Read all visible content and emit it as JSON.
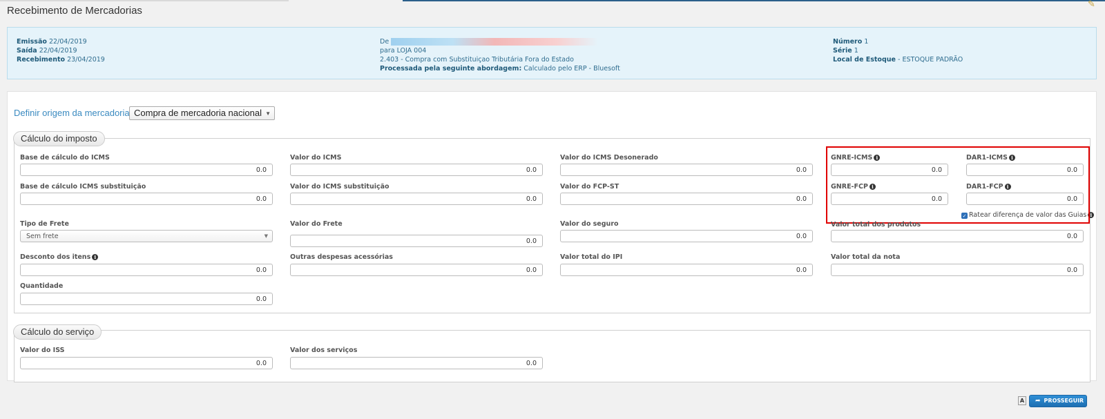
{
  "page": {
    "title": "Recebimento de Mercadorias"
  },
  "info": {
    "emissao_label": "Emissão",
    "emissao_value": "22/04/2019",
    "saida_label": "Saída",
    "saida_value": "22/04/2019",
    "recebimento_label": "Recebimento",
    "recebimento_value": "23/04/2019",
    "de_label": "De",
    "para_text": "para LOJA 004",
    "cfop_text": "2.403 - Compra com Substituiçao Tributária Fora do Estado",
    "processada_label": "Processada pela seguinte abordagem:",
    "processada_value": "Calculado pelo ERP - Bluesoft",
    "numero_label": "Número",
    "numero_value": "1",
    "serie_label": "Série",
    "serie_value": "1",
    "local_label": "Local de Estoque",
    "local_value": "- ESTOQUE PADRÃO"
  },
  "origin": {
    "label": "Definir origem da mercadoria",
    "selected": "Compra de mercadoria nacional"
  },
  "imposto": {
    "legend": "Cálculo do imposto",
    "base_icms": {
      "label": "Base de cálculo do ICMS",
      "value": "0.0"
    },
    "valor_icms": {
      "label": "Valor do ICMS",
      "value": "0.0"
    },
    "icms_desonerado": {
      "label": "Valor do ICMS Desonerado",
      "value": "0.0"
    },
    "gnre_icms": {
      "label": "GNRE-ICMS",
      "value": "0.0"
    },
    "dar1_icms": {
      "label": "DAR1-ICMS",
      "value": "0.0"
    },
    "base_icms_st": {
      "label": "Base de cálculo ICMS substituição",
      "value": "0.0"
    },
    "valor_icms_st": {
      "label": "Valor do ICMS substituição",
      "value": "0.0"
    },
    "fcp_st": {
      "label": "Valor do FCP-ST",
      "value": "0.0"
    },
    "gnre_fcp": {
      "label": "GNRE-FCP",
      "value": "0.0"
    },
    "dar1_fcp": {
      "label": "DAR1-FCP",
      "value": "0.0"
    },
    "ratear_label": "Ratear diferença de valor das Guias",
    "tipo_frete": {
      "label": "Tipo de Frete",
      "selected": "Sem frete"
    },
    "valor_frete": {
      "label": "Valor do Frete",
      "value": "0.0"
    },
    "valor_seguro": {
      "label": "Valor do seguro",
      "value": "0.0"
    },
    "total_produtos": {
      "label": "Valor total dos produtos",
      "value": "0.0"
    },
    "desconto_itens": {
      "label": "Desconto dos itens",
      "value": "0.0"
    },
    "outras_despesas": {
      "label": "Outras despesas acessórias",
      "value": "0.0"
    },
    "total_ipi": {
      "label": "Valor total do IPI",
      "value": "0.0"
    },
    "total_nota": {
      "label": "Valor total da nota",
      "value": "0.0"
    },
    "quantidade": {
      "label": "Quantidade",
      "value": "0.0"
    }
  },
  "servico": {
    "legend": "Cálculo do serviço",
    "valor_iss": {
      "label": "Valor do ISS",
      "value": "0.0"
    },
    "valor_servicos": {
      "label": "Valor dos serviços",
      "value": "0.0"
    }
  },
  "footer": {
    "font_icon_text": "A",
    "proceed_label": "PROSSEGUIR"
  },
  "colors": {
    "accent": "#3a8ac0",
    "primary_button": "#1d6fb2",
    "info_bg": "#e5f3fa",
    "highlight": "#e00000"
  }
}
